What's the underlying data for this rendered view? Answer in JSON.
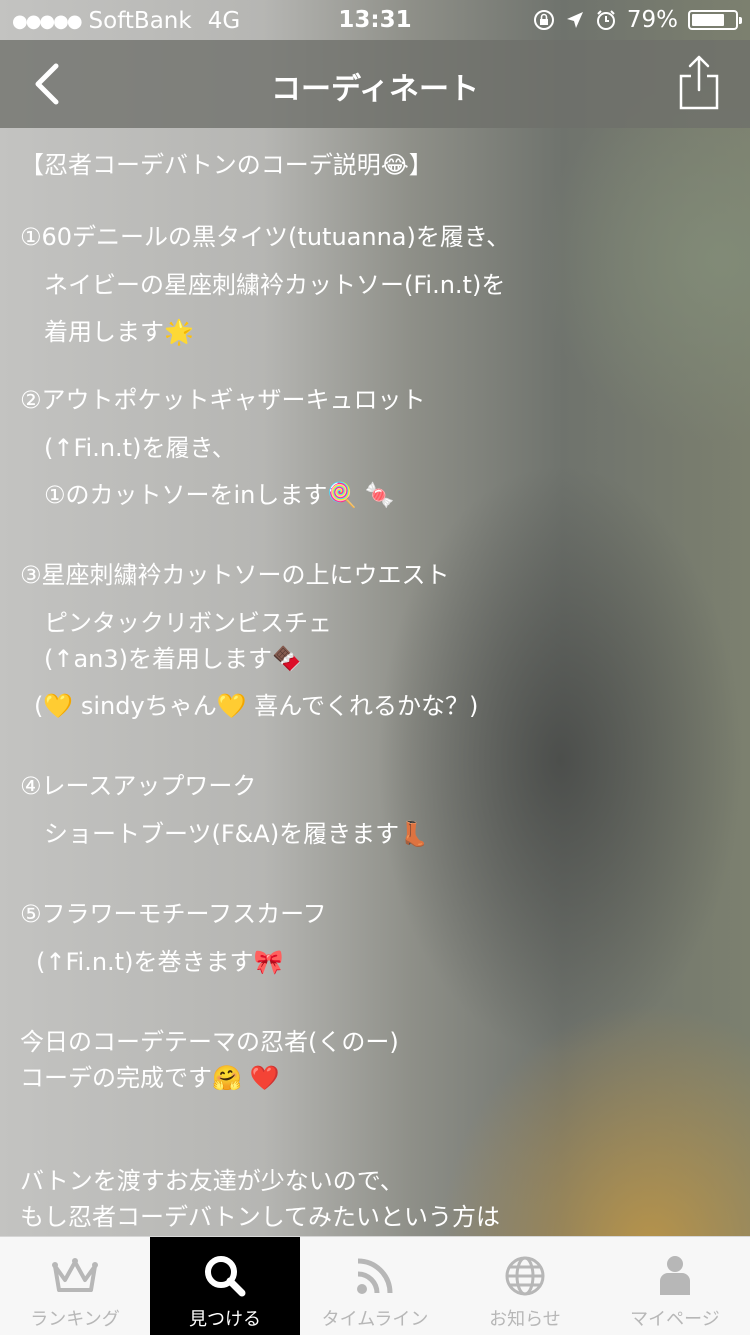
{
  "status_bar": {
    "signal": "●●●●●",
    "carrier": "SoftBank",
    "network": "4G",
    "time": "13:31",
    "battery": "79%",
    "battery_level": 0.79
  },
  "nav": {
    "title": "コーディネート"
  },
  "content": {
    "lines": [
      "【忍者コーデバトンのコーデ説明😂】",
      "①60デニールの黒タイツ(tutuanna)を履き、",
      "ネイビーの星座刺繍衿カットソー(Fi.n.t)を",
      "着用します🌟",
      "②アウトポケットギャザーキュロット",
      "(↑Fi.n.t)を履き、",
      "①のカットソーをinします🍭 🍬",
      "③星座刺繍衿カットソーの上にウエスト",
      "ピンタックリボンビスチェ",
      "(↑an3)を着用します🍫",
      "(💛 sindyちゃん💛 喜んでくれるかな？)",
      "④レースアップワーク",
      "ショートブーツ(F&A)を履きます👢",
      "⑤フラワーモチーフスカーフ",
      "(↑Fi.n.t)を巻きます🎀",
      "今日のコーデテーマの忍者(くのー)",
      "コーデの完成です🤗 ❤️",
      "バトンを渡すお友達が少ないので、",
      "もし忍者コーデバトンしてみたいという方は"
    ]
  },
  "tabs": [
    {
      "label": "ランキング",
      "icon": "crown-icon",
      "active": false
    },
    {
      "label": "見つける",
      "icon": "search-icon",
      "active": true
    },
    {
      "label": "タイムライン",
      "icon": "rss-icon",
      "active": false
    },
    {
      "label": "お知らせ",
      "icon": "globe-icon",
      "active": false
    },
    {
      "label": "マイページ",
      "icon": "person-icon",
      "active": false
    }
  ],
  "colors": {
    "active_tab_bg": "#000000",
    "inactive_tab_text": "#b7b7b7"
  }
}
